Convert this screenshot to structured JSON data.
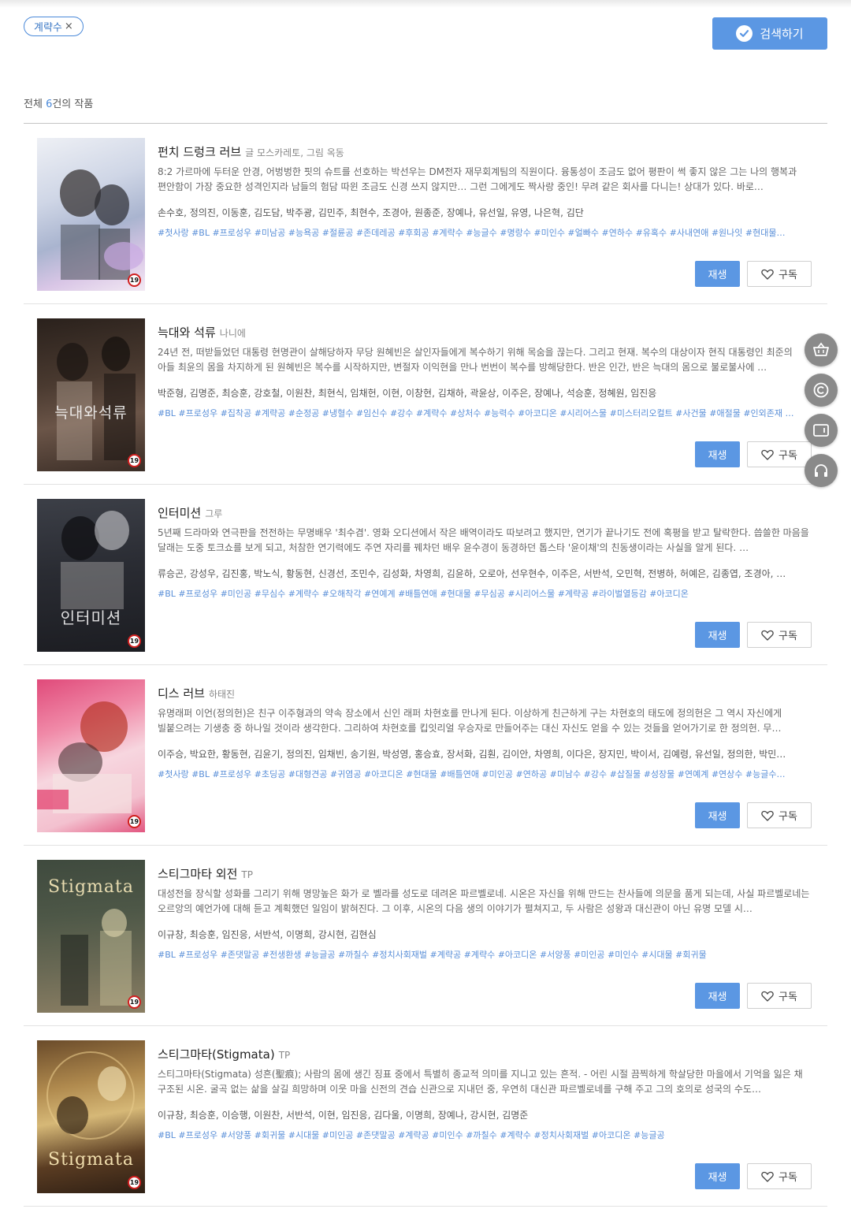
{
  "filter": {
    "chip_label": "계략수",
    "remove_symbol": "×"
  },
  "search_button": {
    "label": "검색하기"
  },
  "summary": {
    "prefix": "전체 ",
    "count": "6",
    "suffix": "건의 작품"
  },
  "buttons": {
    "play": "재생",
    "subscribe": "구독"
  },
  "side_fabs": [
    "basket-icon",
    "copyright-icon",
    "viewer-icon",
    "headphones-icon"
  ],
  "colors": {
    "accent": "#5b97e3",
    "tag": "#5a8fd8",
    "adult_badge": "#d01f1f"
  },
  "works": [
    {
      "title": "펀치 드렁크 러브",
      "author": "글 모스카레토, 그림 옥동",
      "badge": "19",
      "cover_text": "",
      "description": "8:2 가르마에 두터운 안경, 어벙벙한 핏의 슈트를 선호하는 박선우는 DM전자 재무회계팀의 직원이다. 융통성이 조금도 없어 평판이 썩 좋지 않은 그는 나의 행복과 편안함이 가장 중요한 성격인지라 남들의 험담 따윈 조금도 신경 쓰지 않지만… 그런 그에게도 짝사랑 중인! 무려 같은 회사를 다니는! 상대가 있다. 바로…",
      "cast": "손수호, 정의진, 이동훈, 김도담, 박주광, 김민주, 최현수, 조경아, 원종준, 장예나, 유선일, 유영, 나은혁, 김단",
      "tags": "#첫사랑 #BL #프로성우 #미남공 #능욕공 #절륜공 #존데레공 #후회공 #계략수 #능글수 #명랑수 #미인수 #얼빠수 #연하수 #유혹수 #사내연애 #원나잇 #현대물…"
    },
    {
      "title": "늑대와 석류",
      "author": "나니에",
      "badge": "19",
      "cover_text": "늑대와석류",
      "description": "24년 전, 떠받들었던 대통령 현명관이 살해당하자 무당 원혜빈은 살인자들에게 복수하기 위해 목숨을 끊는다. 그리고 현재. 복수의 대상이자 현직 대통령인 최준의 아들 최윤의 몸을 차지하게 된 원혜빈은 복수를 시작하지만, 변절자 이익현을 만나 번번이 복수를 방해당한다. 반은 인간, 반은 늑대의 몸으로 불로불사에 …",
      "cast": "박준형, 김명준, 최승훈, 강호철, 이원찬, 최현식, 임채헌, 이현, 이창현, 김채하, 곽윤상, 이주은, 장예나, 석승훈, 정혜원, 임진응",
      "tags": "#BL #프로성우 #집착공 #계략공 #순정공 #냉혈수 #임신수 #강수 #계략수 #상처수 #능력수 #아코디온 #시리어스물 #미스터리오컬트 #사건물 #애절물 #인외존재 …"
    },
    {
      "title": "인터미션",
      "author": "그루",
      "badge": "19",
      "cover_text": "인터미션",
      "description": "5년째 드라마와 연극판을 전전하는 무명배우 '최수겸'. 영화 오디션에서 작은 배역이라도 따보려고 했지만, 연기가 끝나기도 전에 혹평을 받고 탈락한다. 씁쓸한 마음을 달래는 도중 토크쇼를 보게 되고, 처참한 연기력에도 주연 자리를 꿰차던 배우 윤수경이 동경하던 톱스타 '윤이채'의 친동생이라는 사실을 알게 된다. …",
      "cast": "류승곤, 강성우, 김진홍, 박노식, 황동현, 신경선, 조민수, 김성화, 차영희, 김윤하, 오로아, 선우현수, 이주은, 서반석, 오민혁, 전병하, 허예은, 김종엽, 조경아, …",
      "tags": "#BL #프로성우 #미인공 #무심수 #계략수 #오해착각 #연예계 #배틀연애 #현대물 #무심공 #시리어스물 #계략공 #라이벌열등감 #아코디온"
    },
    {
      "title": "디스 러브",
      "author": "하태진",
      "badge": "19",
      "cover_text": "",
      "description": "유명래퍼 이언(정의헌)은 친구 이주형과의 약속 장소에서 신인 래퍼 차현호를 만나게 된다. 이상하게 친근하게 구는 차현호의 태도에 정의헌은 그 역시 자신에게 빌붙으려는 기생충 중 하나일 것이라 생각한다. 그리하여 차현호를 킵잇리얼 우승자로 만들어주는 대신 자신도 얻을 수 있는 것들을 얻어가기로 한 정의헌. 무…",
      "cast": "이주승, 박요한, 황동현, 김윤기, 정의진, 임채빈, 송기원, 박성영, 홍승효, 장서화, 김훤, 김이안, 차영희, 이다은, 장지민, 박이서, 김예령, 유선일, 정의한, 박민…",
      "tags": "#첫사랑 #BL #프로성우 #초딩공 #대형견공 #귀염공 #아코디온 #현대물 #배틀연애 #미인공 #연하공 #미남수 #강수 #삽질물 #성장물 #연예계 #연상수 #능글수…"
    },
    {
      "title": "스티그마타 외전",
      "author": "TP",
      "badge": "19",
      "cover_text": "Stigmata",
      "description": "대성전을 장식할 성화를 그리기 위해 명망높은 화가 로 벨라를 성도로 데려온 파르벨로네. 시온은 자신을 위해 만드는 찬사들에 의문을 품게 되는데, 사실 파르벨로네는 오르앙의 예언가에 대해 듣고 계획했던 일임이 밝혀진다. 그 이후, 시온의 다음 생의 이야기가 펼쳐지고, 두 사람은 성왕과 대신관이 아닌 유명 모델 시…",
      "cast": "이규창, 최승훈, 임진응, 서반석, 이명희, 강시현, 김현심",
      "tags": "#BL #프로성우 #존댓말공 #전생환생 #능글공 #까칠수 #정치사회재벌 #계략공 #계략수 #아코디온 #서양풍 #미인공 #미인수 #시대물 #회귀물"
    },
    {
      "title": "스티그마타(Stigmata)",
      "author": "TP",
      "badge": "19",
      "cover_text": "Stigmata",
      "description": "스티그마타(Stigmata) 성흔(聖痕); 사람의 몸에 생긴 징표 중에서 특별히 종교적 의미를 지니고 있는 흔적. - 어린 시절 끔찍하게 학살당한 마을에서 기억을 잃은 채 구조된 시온. 굴곡 없는 삶을 살길 희망하며 이웃 마을 신전의 견습 신관으로 지내던 중, 우연히 대신관 파르벨로네를 구해 주고 그의 호의로 성국의 수도…",
      "cast": "이규창, 최승훈, 이승행, 이원찬, 서반석, 이현, 임진응, 김다울, 이명희, 장예나, 강시현, 김명준",
      "tags": "#BL #프로성우 #서양풍 #회귀물 #시대물 #미인공 #존댓말공 #계략공 #미인수 #까칠수 #계략수 #정치사회재벌 #아코디온 #능글공"
    }
  ]
}
